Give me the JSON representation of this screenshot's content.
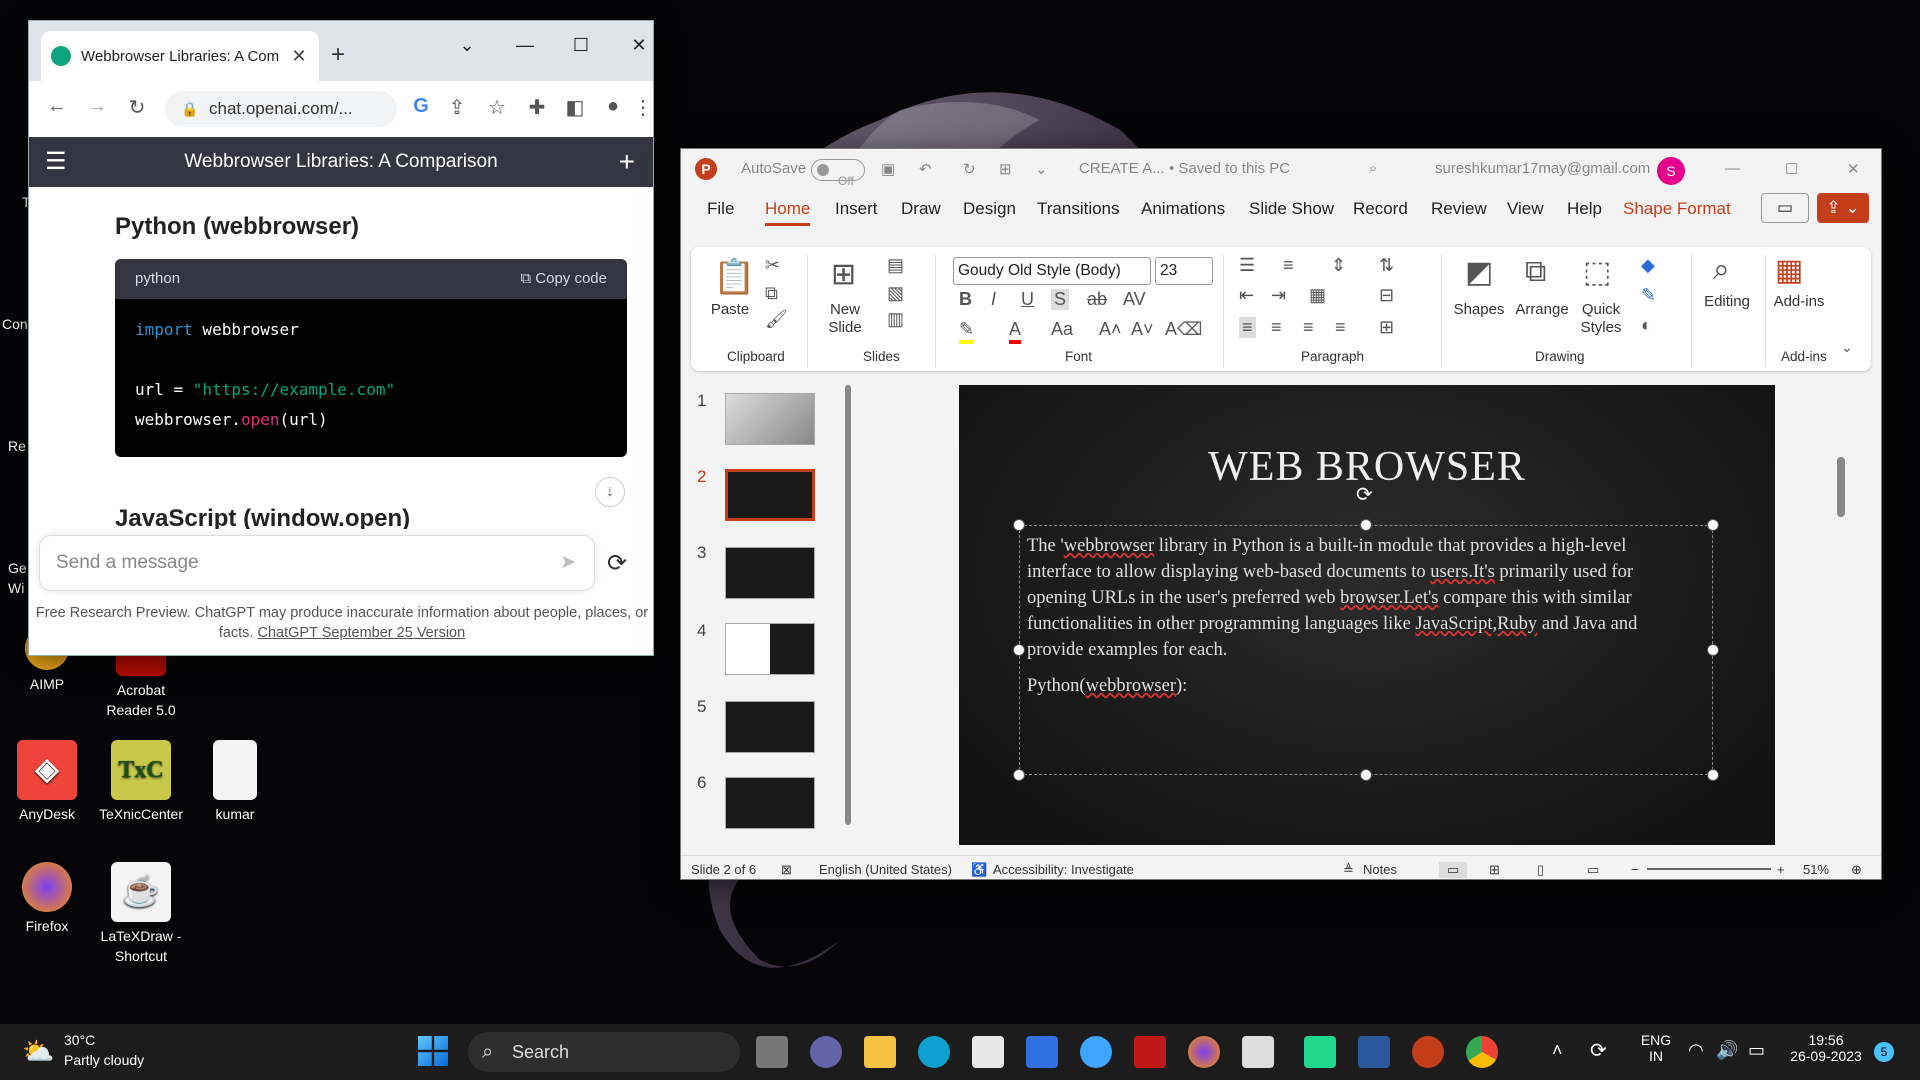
{
  "desktop": {
    "icons": [
      {
        "label": "AIMP"
      },
      {
        "label": "Acrobat Reader 5.0"
      },
      {
        "label": "AnyDesk"
      },
      {
        "label": "TeXnicCenter"
      },
      {
        "label": "kumar"
      },
      {
        "label": "Firefox"
      },
      {
        "label": "LaTeXDraw - Shortcut"
      }
    ],
    "partial_labels": [
      "Con",
      "Re",
      "Ge",
      "Wi",
      "T"
    ]
  },
  "chrome": {
    "tab_title": "Webbrowser Libraries: A Com",
    "url": "chat.openai.com/...",
    "header_title": "Webbrowser Libraries: A Comparison",
    "section1": "Python (webbrowser)",
    "code_lang": "python",
    "copy_label": "Copy code",
    "code": {
      "l1_kw": "import",
      "l1_mod": " webbrowser",
      "l2_var": "url = ",
      "l2_str": "\"https://example.com\"",
      "l3_obj": "webbrowser.",
      "l3_fn": "open",
      "l3_args": "(url)"
    },
    "section2": "JavaScript (window.open)",
    "input_placeholder": "Send a message",
    "footer_text": "Free Research Preview. ChatGPT may produce inaccurate information about people, places, or facts.",
    "footer_link": "ChatGPT September 25 Version"
  },
  "ppt": {
    "autosave": "AutoSave",
    "autosave_state": "Off",
    "doc_name": "CREATE A...",
    "saved_status": "• Saved to this PC",
    "email": "sureshkumar17may@gmail.com",
    "avatar_letter": "S",
    "menu": [
      "File",
      "Home",
      "Insert",
      "Draw",
      "Design",
      "Transitions",
      "Animations",
      "Slide Show",
      "Record",
      "Review",
      "View",
      "Help",
      "Shape Format"
    ],
    "ribbon": {
      "paste": "Paste",
      "new_slide": "New Slide",
      "font_name": "Goudy Old Style (Body)",
      "font_size": "23",
      "shapes": "Shapes",
      "arrange": "Arrange",
      "quick_styles": "Quick Styles",
      "editing": "Editing",
      "addins": "Add-ins",
      "groups": [
        "Clipboard",
        "Slides",
        "Font",
        "Paragraph",
        "Drawing",
        "Add-ins"
      ]
    },
    "thumb_numbers": [
      "1",
      "2",
      "3",
      "4",
      "5",
      "6"
    ],
    "slide": {
      "title": "WEB BROWSER",
      "para1_a": "The '",
      "para1_b": "webbrowser",
      "para1_c": " library in Python is a built-in module that provides a high-level interface to allow displaying web-based documents to ",
      "para1_d": "users.It's",
      "para1_e": " primarily used for opening URLs in the user's preferred web ",
      "para1_f": "browser.Let's",
      "para1_g": " compare this with similar functionalities in other programming languages like ",
      "para1_h": "JavaScript,Ruby",
      "para1_i": " and Java and provide examples for each.",
      "para2_a": "Python(",
      "para2_b": "webbrowser",
      "para2_c": "):"
    },
    "status": {
      "slide_info": "Slide 2 of 6",
      "language": "English (United States)",
      "accessibility": "Accessibility: Investigate",
      "notes": "Notes",
      "zoom": "51%"
    }
  },
  "taskbar": {
    "temp": "30°C",
    "weather": "Partly cloudy",
    "search": "Search",
    "lang1": "ENG",
    "lang2": "IN",
    "time": "19:56",
    "date": "26-09-2023",
    "badge": "5"
  }
}
